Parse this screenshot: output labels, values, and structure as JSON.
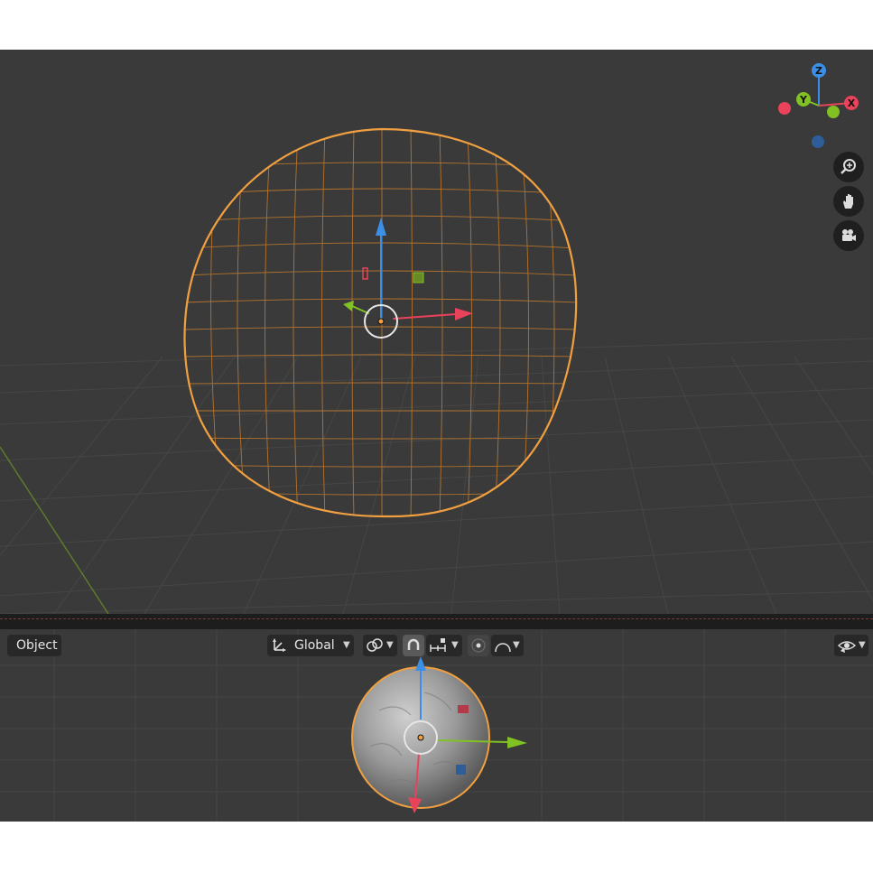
{
  "header": {
    "mode_label": "Object",
    "transform_orientation": "Global"
  },
  "gizmo": {
    "axes": {
      "x_label": "X",
      "y_label": "Y",
      "z_label": "Z"
    }
  },
  "colors": {
    "viewport_bg": "#3a3a3a",
    "grid_line": "#454545",
    "selection_outline": "#f0a040",
    "axis_x": "#e8435a",
    "axis_y": "#82c124",
    "axis_z": "#3c8fe6"
  },
  "icons": {
    "zoom": "zoom-icon",
    "pan": "hand-icon",
    "camera": "camera-icon",
    "orientation": "transform-orientation-icon",
    "pivot": "pivot-point-icon",
    "snap": "snap-icon",
    "snap_increment": "snap-increment-icon",
    "proportional": "proportional-editing-icon",
    "falloff": "falloff-curve-icon",
    "visibility": "visibility-icon"
  }
}
